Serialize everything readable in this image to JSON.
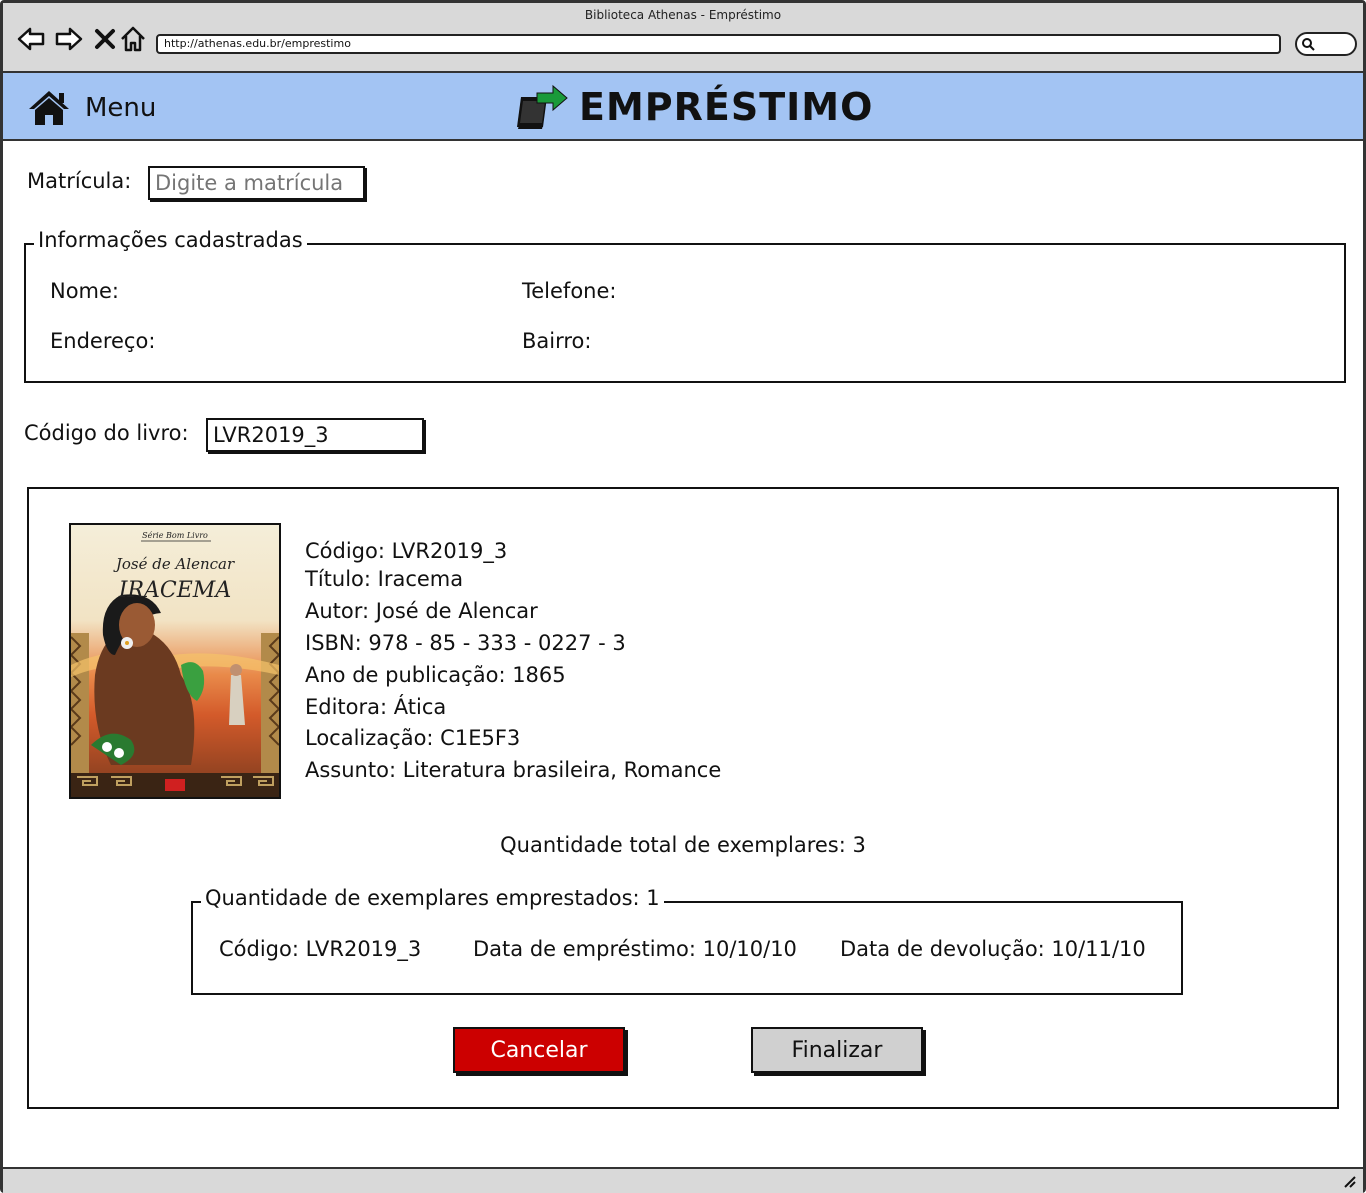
{
  "window": {
    "title": "Biblioteca Athenas - Empréstimo"
  },
  "browser": {
    "url": "http://athenas.edu.br/emprestimo",
    "nav_icons": [
      "back-arrow-icon",
      "forward-arrow-icon",
      "close-x-icon",
      "home-outline-icon"
    ],
    "search_icon": "search-icon"
  },
  "header": {
    "menu_label": "Menu",
    "menu_icon": "home-icon",
    "title": "EMPRÉSTIMO",
    "title_icon": "book-export-icon",
    "bg_color": "#a3c4f3"
  },
  "form": {
    "matricula_label": "Matrícula:",
    "matricula_placeholder": "Digite a matrícula",
    "codigo_label": "Código do livro:",
    "codigo_value": "LVR2019_3"
  },
  "user_info": {
    "legend": "Informações cadastradas",
    "nome_label": "Nome:",
    "telefone_label": "Telefone:",
    "endereco_label": "Endereço:",
    "bairro_label": "Bairro:"
  },
  "book": {
    "cover": {
      "series": "Série Bom Livro",
      "author": "José de Alencar",
      "title": "IRACEMA"
    },
    "details": [
      "Código: LVR2019_3",
      "Título: Iracema",
      "Autor: José de Alencar",
      "ISBN: 978 - 85 - 333 - 0227 - 3",
      "Ano de publicação: 1865",
      "Editora: Ática",
      "Localização: C1E5F3",
      "Assunto: Literatura brasileira, Romance"
    ],
    "total_copies": "Quantidade total de exemplares: 3"
  },
  "loans": {
    "legend": "Quantidade de exemplares emprestados: 1",
    "entries": [
      {
        "codigo": "Código: LVR2019_3",
        "data_emprestimo": "Data de empréstimo: 10/10/10",
        "data_devolucao": "Data de devolução: 10/11/10"
      }
    ]
  },
  "actions": {
    "cancel_label": "Cancelar",
    "finish_label": "Finalizar",
    "cancel_color": "#cc0000",
    "finish_color": "#d0d0d0"
  }
}
